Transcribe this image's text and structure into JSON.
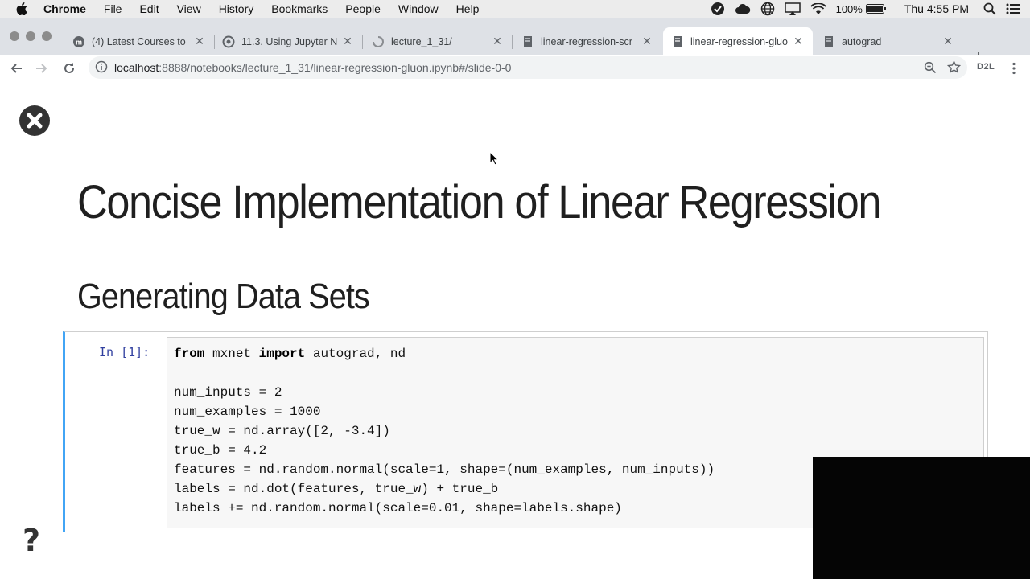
{
  "menubar": {
    "app": "Chrome",
    "menus": [
      "File",
      "Edit",
      "View",
      "History",
      "Bookmarks",
      "People",
      "Window",
      "Help"
    ],
    "battery": "100%",
    "clock": "Thu 4:55 PM"
  },
  "tabs": [
    {
      "title": "(4) Latest Courses to",
      "favicon": "m-icon"
    },
    {
      "title": "11.3. Using Jupyter N",
      "favicon": "globe-icon"
    },
    {
      "title": "lecture_1_31/",
      "favicon": "loading-icon"
    },
    {
      "title": "linear-regression-scr",
      "favicon": "notebook-icon"
    },
    {
      "title": "linear-regression-gluo",
      "favicon": "notebook-icon",
      "active": true
    },
    {
      "title": "autograd",
      "favicon": "notebook-icon"
    }
  ],
  "address": {
    "host": "localhost",
    "rest": ":8888/notebooks/lecture_1_31/linear-regression-gluon.ipynb#/slide-0-0"
  },
  "extension_label": "D2L",
  "slide": {
    "title": "Concise Implementation of Linear Regression",
    "subtitle": "Generating Data Sets",
    "cell_prompt": "In [1]:",
    "code_lines": [
      [
        {
          "t": "from",
          "k": true
        },
        {
          "t": " mxnet "
        },
        {
          "t": "import",
          "k": true
        },
        {
          "t": " autograd, nd"
        }
      ],
      [
        {
          "t": ""
        }
      ],
      [
        {
          "t": "num_inputs = 2"
        }
      ],
      [
        {
          "t": "num_examples = 1000"
        }
      ],
      [
        {
          "t": "true_w = nd.array([2, -3.4])"
        }
      ],
      [
        {
          "t": "true_b = 4.2"
        }
      ],
      [
        {
          "t": "features = nd.random.normal(scale=1, shape=(num_examples, num_inputs))"
        }
      ],
      [
        {
          "t": "labels = nd.dot(features, true_w) + true_b"
        }
      ],
      [
        {
          "t": "labels += nd.random.normal(scale=0.01, shape=labels.shape)"
        }
      ]
    ]
  }
}
